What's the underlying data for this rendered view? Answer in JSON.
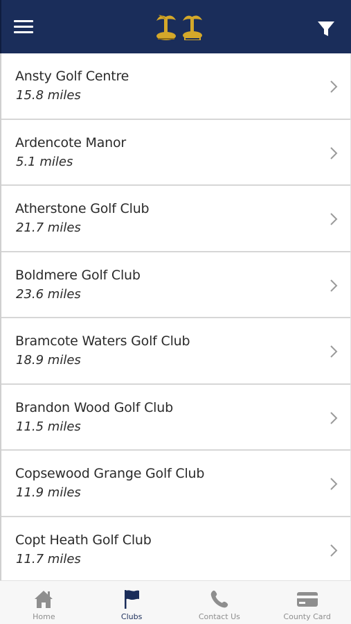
{
  "header": {
    "menu_icon": "hamburger-icon",
    "filter_icon": "filter-icon",
    "colors": {
      "background": "#1a2d5a",
      "accent": "#d4a82a"
    }
  },
  "clubs": [
    {
      "name": "Ansty Golf Centre",
      "distance": "15.8 miles"
    },
    {
      "name": "Ardencote Manor",
      "distance": "5.1 miles"
    },
    {
      "name": "Atherstone Golf Club",
      "distance": "21.7 miles"
    },
    {
      "name": "Boldmere Golf Club",
      "distance": "23.6 miles"
    },
    {
      "name": "Bramcote Waters Golf Club",
      "distance": "18.9 miles"
    },
    {
      "name": "Brandon Wood Golf Club",
      "distance": "11.5 miles"
    },
    {
      "name": "Copsewood Grange Golf Club",
      "distance": "11.9 miles"
    },
    {
      "name": "Copt Heath Golf Club",
      "distance": "11.7 miles"
    }
  ],
  "tabs": [
    {
      "label": "Home",
      "icon": "home-icon",
      "active": false
    },
    {
      "label": "Clubs",
      "icon": "flag-icon",
      "active": true
    },
    {
      "label": "Contact Us",
      "icon": "phone-icon",
      "active": false
    },
    {
      "label": "County Card",
      "icon": "card-icon",
      "active": false
    }
  ]
}
